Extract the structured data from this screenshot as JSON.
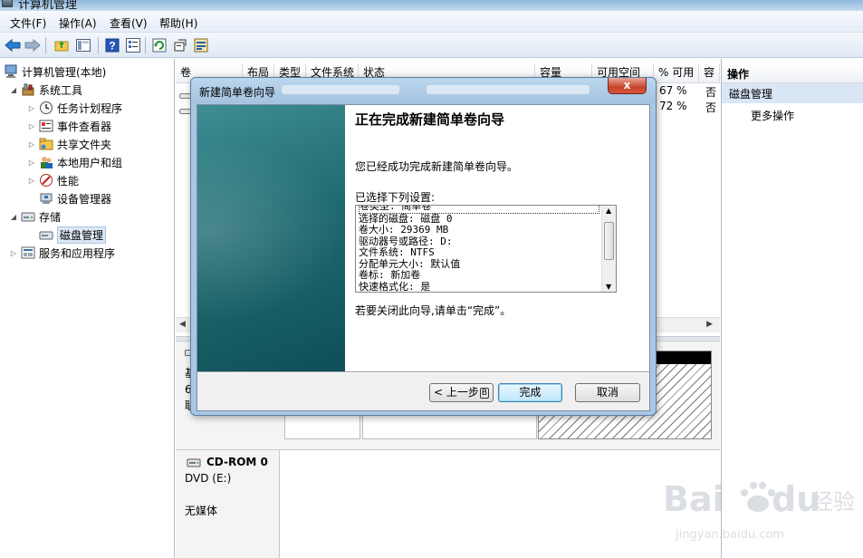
{
  "window": {
    "title": "计算机管理"
  },
  "menu": [
    "文件(F)",
    "操作(A)",
    "查看(V)",
    "帮助(H)"
  ],
  "toolbar": [
    "back-arrow-icon",
    "forward-arrow-icon",
    "up-folder-icon",
    "show-hide-tree-icon",
    "help-icon",
    "properties-icon",
    "refresh-icon",
    "settings-icon",
    "export-icon"
  ],
  "tree": {
    "root": "计算机管理(本地)",
    "system_tools": "系统工具",
    "task_scheduler": "任务计划程序",
    "event_viewer": "事件查看器",
    "shared_folders": "共享文件夹",
    "local_users": "本地用户和组",
    "performance": "性能",
    "device_manager": "设备管理器",
    "storage": "存储",
    "disk_management": "磁盘管理",
    "services_apps": "服务和应用程序"
  },
  "volume_list": {
    "columns": [
      "卷",
      "布局",
      "类型",
      "文件系统",
      "状态",
      "容量",
      "可用空间",
      "% 可用",
      "容"
    ],
    "rows": [
      {
        "pct_free": "67 %",
        "fault_tolerance": "否"
      },
      {
        "pct_free": "72 %",
        "fault_tolerance": "否"
      }
    ]
  },
  "disk_panel": {
    "disk0_lines": [
      "基",
      "6",
      "联"
    ],
    "cdrom_title": "CD-ROM 0",
    "cdrom_type": "DVD (E:)",
    "cdrom_media": "无媒体"
  },
  "actions": {
    "header": "操作",
    "section": "磁盘管理",
    "more": "更多操作"
  },
  "wizard": {
    "title": "新建简单卷向导",
    "close": "x",
    "heading": "正在完成新建简单卷向导",
    "success_text": "您已经成功完成新建简单卷向导。",
    "selected_label": "已选择下列设置:",
    "settings_lines": [
      "卷类型: 简单卷",
      "选择的磁盘: 磁盘 0",
      "卷大小: 29369 MB",
      "驱动器号或路径: D:",
      "文件系统: NTFS",
      "分配单元大小: 默认值",
      "卷标: 新加卷",
      "快速格式化: 是"
    ],
    "close_hint": "若要关闭此向导,请单击“完成”。",
    "back_label": "< 上一步",
    "back_accel": "B",
    "finish_label": "完成",
    "cancel_label": "取消"
  },
  "watermark": {
    "brand": "Bai",
    "brand2": "du",
    "product": "经验",
    "url": "jingyan.baidu.com"
  }
}
